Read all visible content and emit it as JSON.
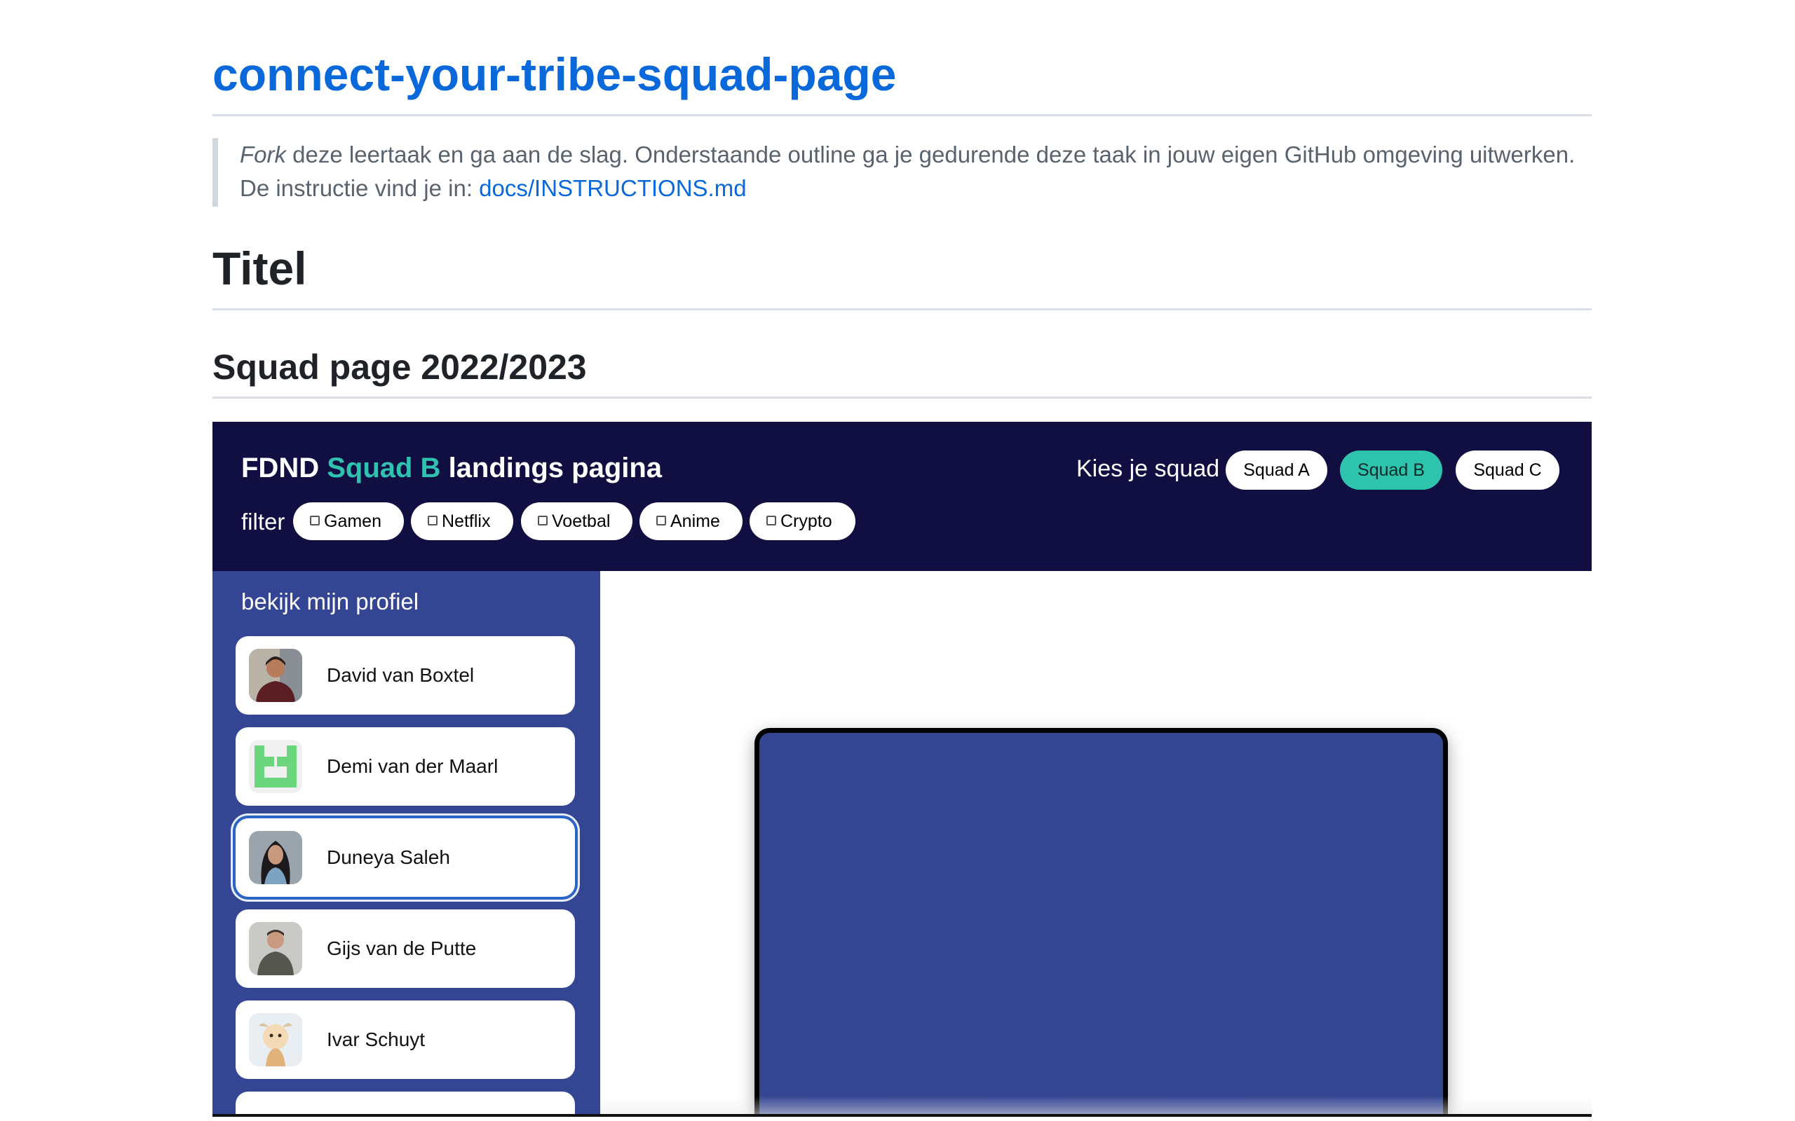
{
  "readme": {
    "repo_title": "connect-your-tribe-squad-page",
    "quote_em": "Fork",
    "quote_rest": " deze leertaak en ga aan de slag. Onderstaande outline ga je gedurende deze taak in jouw eigen GitHub omgeving uitwerken.",
    "quote_line2_prefix": "De instructie vind je in: ",
    "quote_link": "docs/INSTRUCTIONS.md",
    "h1": "Titel",
    "h2": "Squad page 2022/2023"
  },
  "app": {
    "brand_prefix": "FDND ",
    "brand_accent": "Squad B",
    "brand_suffix": " landings pagina",
    "squad_label": "Kies je squad",
    "squads": [
      {
        "label": "Squad A",
        "active": false
      },
      {
        "label": "Squad B",
        "active": true
      },
      {
        "label": "Squad C",
        "active": false
      }
    ],
    "filter_label": "filter",
    "filters": [
      "Gamen",
      "Netflix",
      "Voetbal",
      "Anime",
      "Crypto"
    ],
    "sidebar_title": "bekijk mijn profiel",
    "members": [
      {
        "name": "David van Boxtel"
      },
      {
        "name": "Demi van der Maarl"
      },
      {
        "name": "Duneya Saleh",
        "selected": true
      },
      {
        "name": "Gijs van de Putte"
      },
      {
        "name": "Ivar Schuyt"
      }
    ],
    "colors": {
      "header_bg": "#110f42",
      "accent": "#2fc2b1",
      "sidebar_bg": "#344693",
      "link": "#0969da"
    }
  }
}
